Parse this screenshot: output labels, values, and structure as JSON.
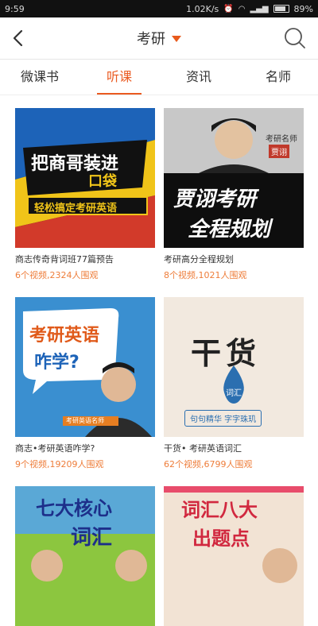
{
  "status": {
    "time": "9:59",
    "speed": "1.02K/s",
    "battery": "89%"
  },
  "header": {
    "title": "考研"
  },
  "tabs": [
    {
      "label": "微课书"
    },
    {
      "label": "听课"
    },
    {
      "label": "资讯"
    },
    {
      "label": "名师"
    }
  ],
  "cards": [
    {
      "title": "商志传奇背词班77篇预告",
      "meta": "6个视频,2324人围观",
      "thumb": {
        "line1": "把商哥装进",
        "line2": "口袋",
        "banner": "轻松搞定考研英语"
      }
    },
    {
      "title": "考研高分全程规划",
      "meta": "8个视频,1021人围观",
      "thumb": {
        "tag": "考研名师",
        "name": "贾诩",
        "line1": "贾诩考研",
        "line2": "全程规划"
      }
    },
    {
      "title": "商志•考研英语咋学?",
      "meta": "9个视频,19209人围观",
      "thumb": {
        "line1": "考研英语",
        "line2": "咋学?",
        "caption": "考研英语名师"
      }
    },
    {
      "title": "干货• 考研英语词汇",
      "meta": "62个视频,6799人围观",
      "thumb": {
        "line1": "干货",
        "sub": "词汇",
        "slogan": "句句精华  字字珠玑"
      }
    },
    {
      "title": "",
      "meta": "",
      "thumb": {
        "line1": "七大核心",
        "line2": "词汇"
      }
    },
    {
      "title": "",
      "meta": "",
      "thumb": {
        "line1": "词汇八大",
        "line2": "出题点"
      }
    }
  ]
}
